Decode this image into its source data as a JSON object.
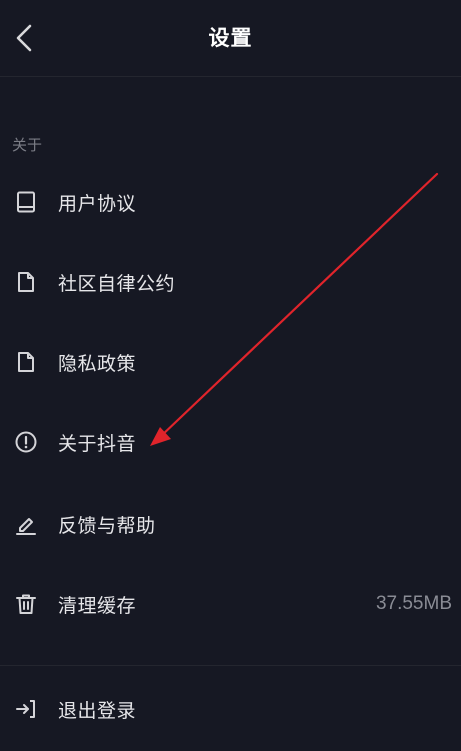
{
  "header": {
    "title": "设置"
  },
  "section": {
    "label": "关于"
  },
  "items": [
    {
      "label": "用户协议",
      "icon": "book-icon"
    },
    {
      "label": "社区自律公约",
      "icon": "document-icon"
    },
    {
      "label": "隐私政策",
      "icon": "document-icon"
    },
    {
      "label": "关于抖音",
      "icon": "info-icon"
    },
    {
      "label": "反馈与帮助",
      "icon": "pencil-icon"
    },
    {
      "label": "清理缓存",
      "icon": "trash-icon",
      "value": "37.55MB"
    },
    {
      "label": "退出登录",
      "icon": "logout-icon"
    }
  ],
  "colors": {
    "background": "#161823",
    "annotation_arrow": "#e0242b"
  }
}
